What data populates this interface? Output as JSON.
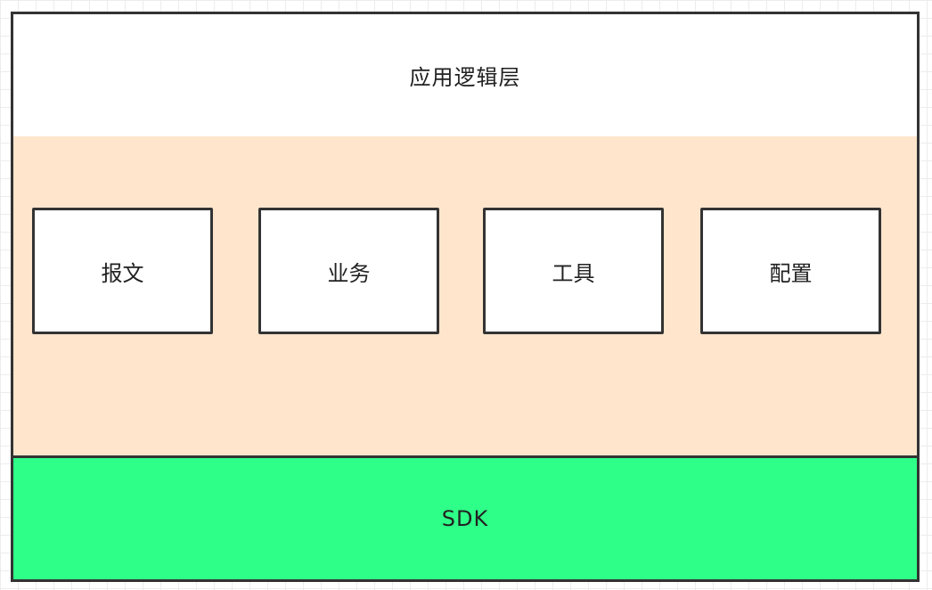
{
  "layers": {
    "app_logic": {
      "label": "应用逻辑层",
      "fill": "#ffffff"
    },
    "middle": {
      "fill": "#ffe5cc"
    },
    "sdk": {
      "label": "SDK",
      "fill": "#2eff88"
    }
  },
  "modules": [
    {
      "label": "报文"
    },
    {
      "label": "业务"
    },
    {
      "label": "工具"
    },
    {
      "label": "配置"
    }
  ],
  "colors": {
    "border": "#333333",
    "grid": "#ececec"
  }
}
